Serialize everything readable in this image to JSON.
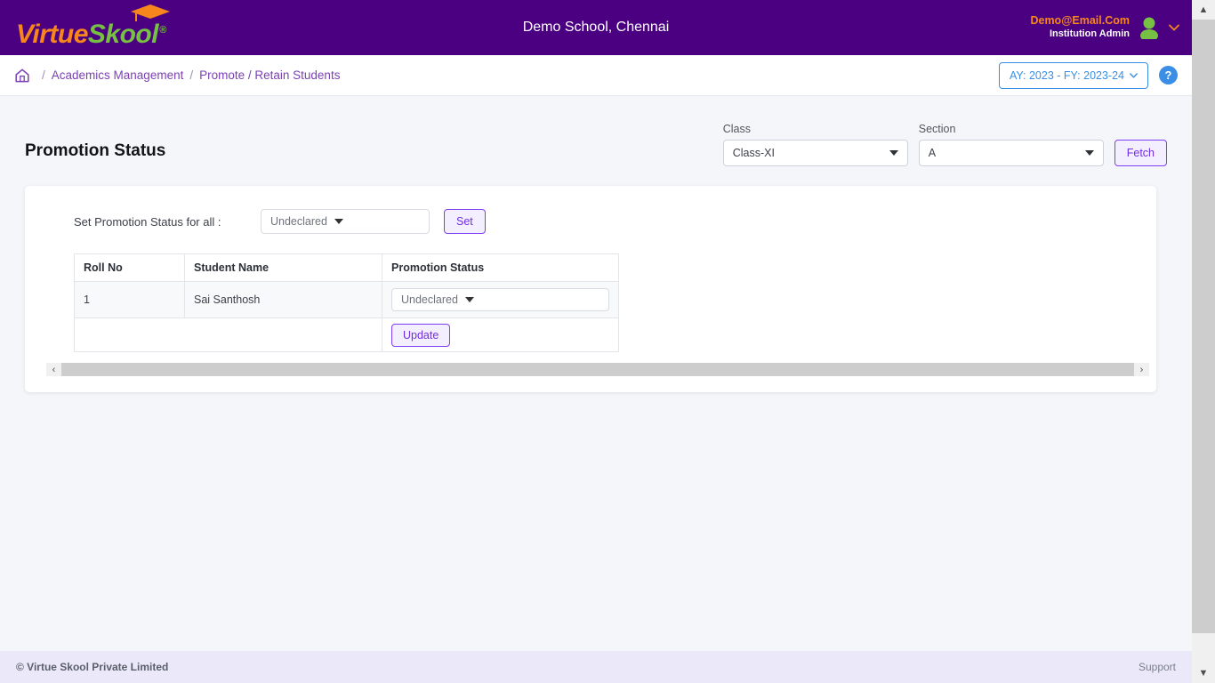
{
  "header": {
    "logo": {
      "part1": "Virtue",
      "part2": "Skool",
      "registered": "®",
      "cap_icon": "graduation-cap-icon"
    },
    "school_name": "Demo School, Chennai",
    "user": {
      "email": "Demo@Email.Com",
      "role": "Institution Admin",
      "avatar_icon": "user-avatar-icon",
      "caret_icon": "chevron-down-icon"
    }
  },
  "breadcrumb": {
    "home_icon": "home-icon",
    "separator": "/",
    "items": [
      {
        "label": "Academics Management"
      },
      {
        "label": "Promote / Retain Students"
      }
    ],
    "academic_year": {
      "label": "AY: 2023 - FY: 2023-24",
      "caret_icon": "chevron-down-icon"
    },
    "help": {
      "label": "?",
      "icon": "help-circle-icon"
    }
  },
  "main": {
    "title": "Promotion Status",
    "filters": {
      "class": {
        "label": "Class",
        "value": "Class-XI"
      },
      "section": {
        "label": "Section",
        "value": "A"
      },
      "fetch_label": "Fetch"
    },
    "set_all": {
      "label": "Set Promotion Status for all :",
      "value": "Undeclared",
      "button_label": "Set"
    },
    "table": {
      "columns": [
        "Roll No",
        "Student Name",
        "Promotion Status"
      ],
      "rows": [
        {
          "roll_no": "1",
          "student_name": "Sai Santhosh",
          "promotion_status": "Undeclared"
        }
      ],
      "update_label": "Update"
    },
    "hscroll": {
      "left_icon": "chevron-left-icon",
      "right_icon": "chevron-right-icon"
    }
  },
  "footer": {
    "copyright": "© Virtue Skool Private Limited",
    "support": "Support"
  },
  "scrollbar": {
    "up_icon": "chevron-up-icon",
    "down_icon": "chevron-down-icon"
  },
  "colors": {
    "header_purple": "#4B0082",
    "logo_orange": "#F7861C",
    "logo_green": "#76C043",
    "accent_purple": "#7E3FF2",
    "link_purple": "#7B3FB5",
    "accent_blue": "#3A8EE6",
    "footer_lavender": "#EBE8FA",
    "body_bg": "#F5F6FA"
  }
}
